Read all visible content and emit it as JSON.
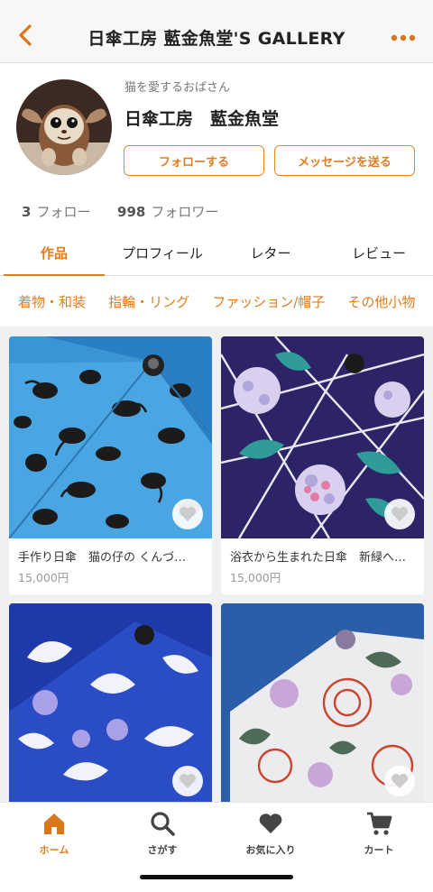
{
  "header": {
    "title": "日傘工房  藍金魚堂'S GALLERY"
  },
  "profile": {
    "subtitle": "猫を愛するおばさん",
    "name": "日傘工房　藍金魚堂",
    "follow_label": "フォローする",
    "message_label": "メッセージを送る",
    "following_count": "3",
    "following_label": "フォロー",
    "followers_count": "998",
    "followers_label": "フォロワー"
  },
  "tabs": [
    {
      "label": "作品",
      "active": true
    },
    {
      "label": "プロフィール"
    },
    {
      "label": "レター"
    },
    {
      "label": "レビュー"
    }
  ],
  "categories": [
    "着物・和装",
    "指輪・リング",
    "ファッション/帽子",
    "その他小物"
  ],
  "products": [
    {
      "name": "手作り日傘　猫の仔の くんづ…",
      "price": "15,000円"
    },
    {
      "name": "浴衣から生まれた日傘　新緑へ…",
      "price": "15,000円"
    },
    {
      "name": "",
      "price": ""
    },
    {
      "name": "",
      "price": ""
    }
  ],
  "nav": [
    {
      "label": "ホーム",
      "icon": "home-icon",
      "active": true
    },
    {
      "label": "さがす",
      "icon": "search-icon"
    },
    {
      "label": "お気に入り",
      "icon": "heart-icon"
    },
    {
      "label": "カート",
      "icon": "cart-icon"
    }
  ],
  "colors": {
    "accent": "#e07c1e",
    "background": "#ffffff",
    "grid_background": "#f0f0f0"
  }
}
